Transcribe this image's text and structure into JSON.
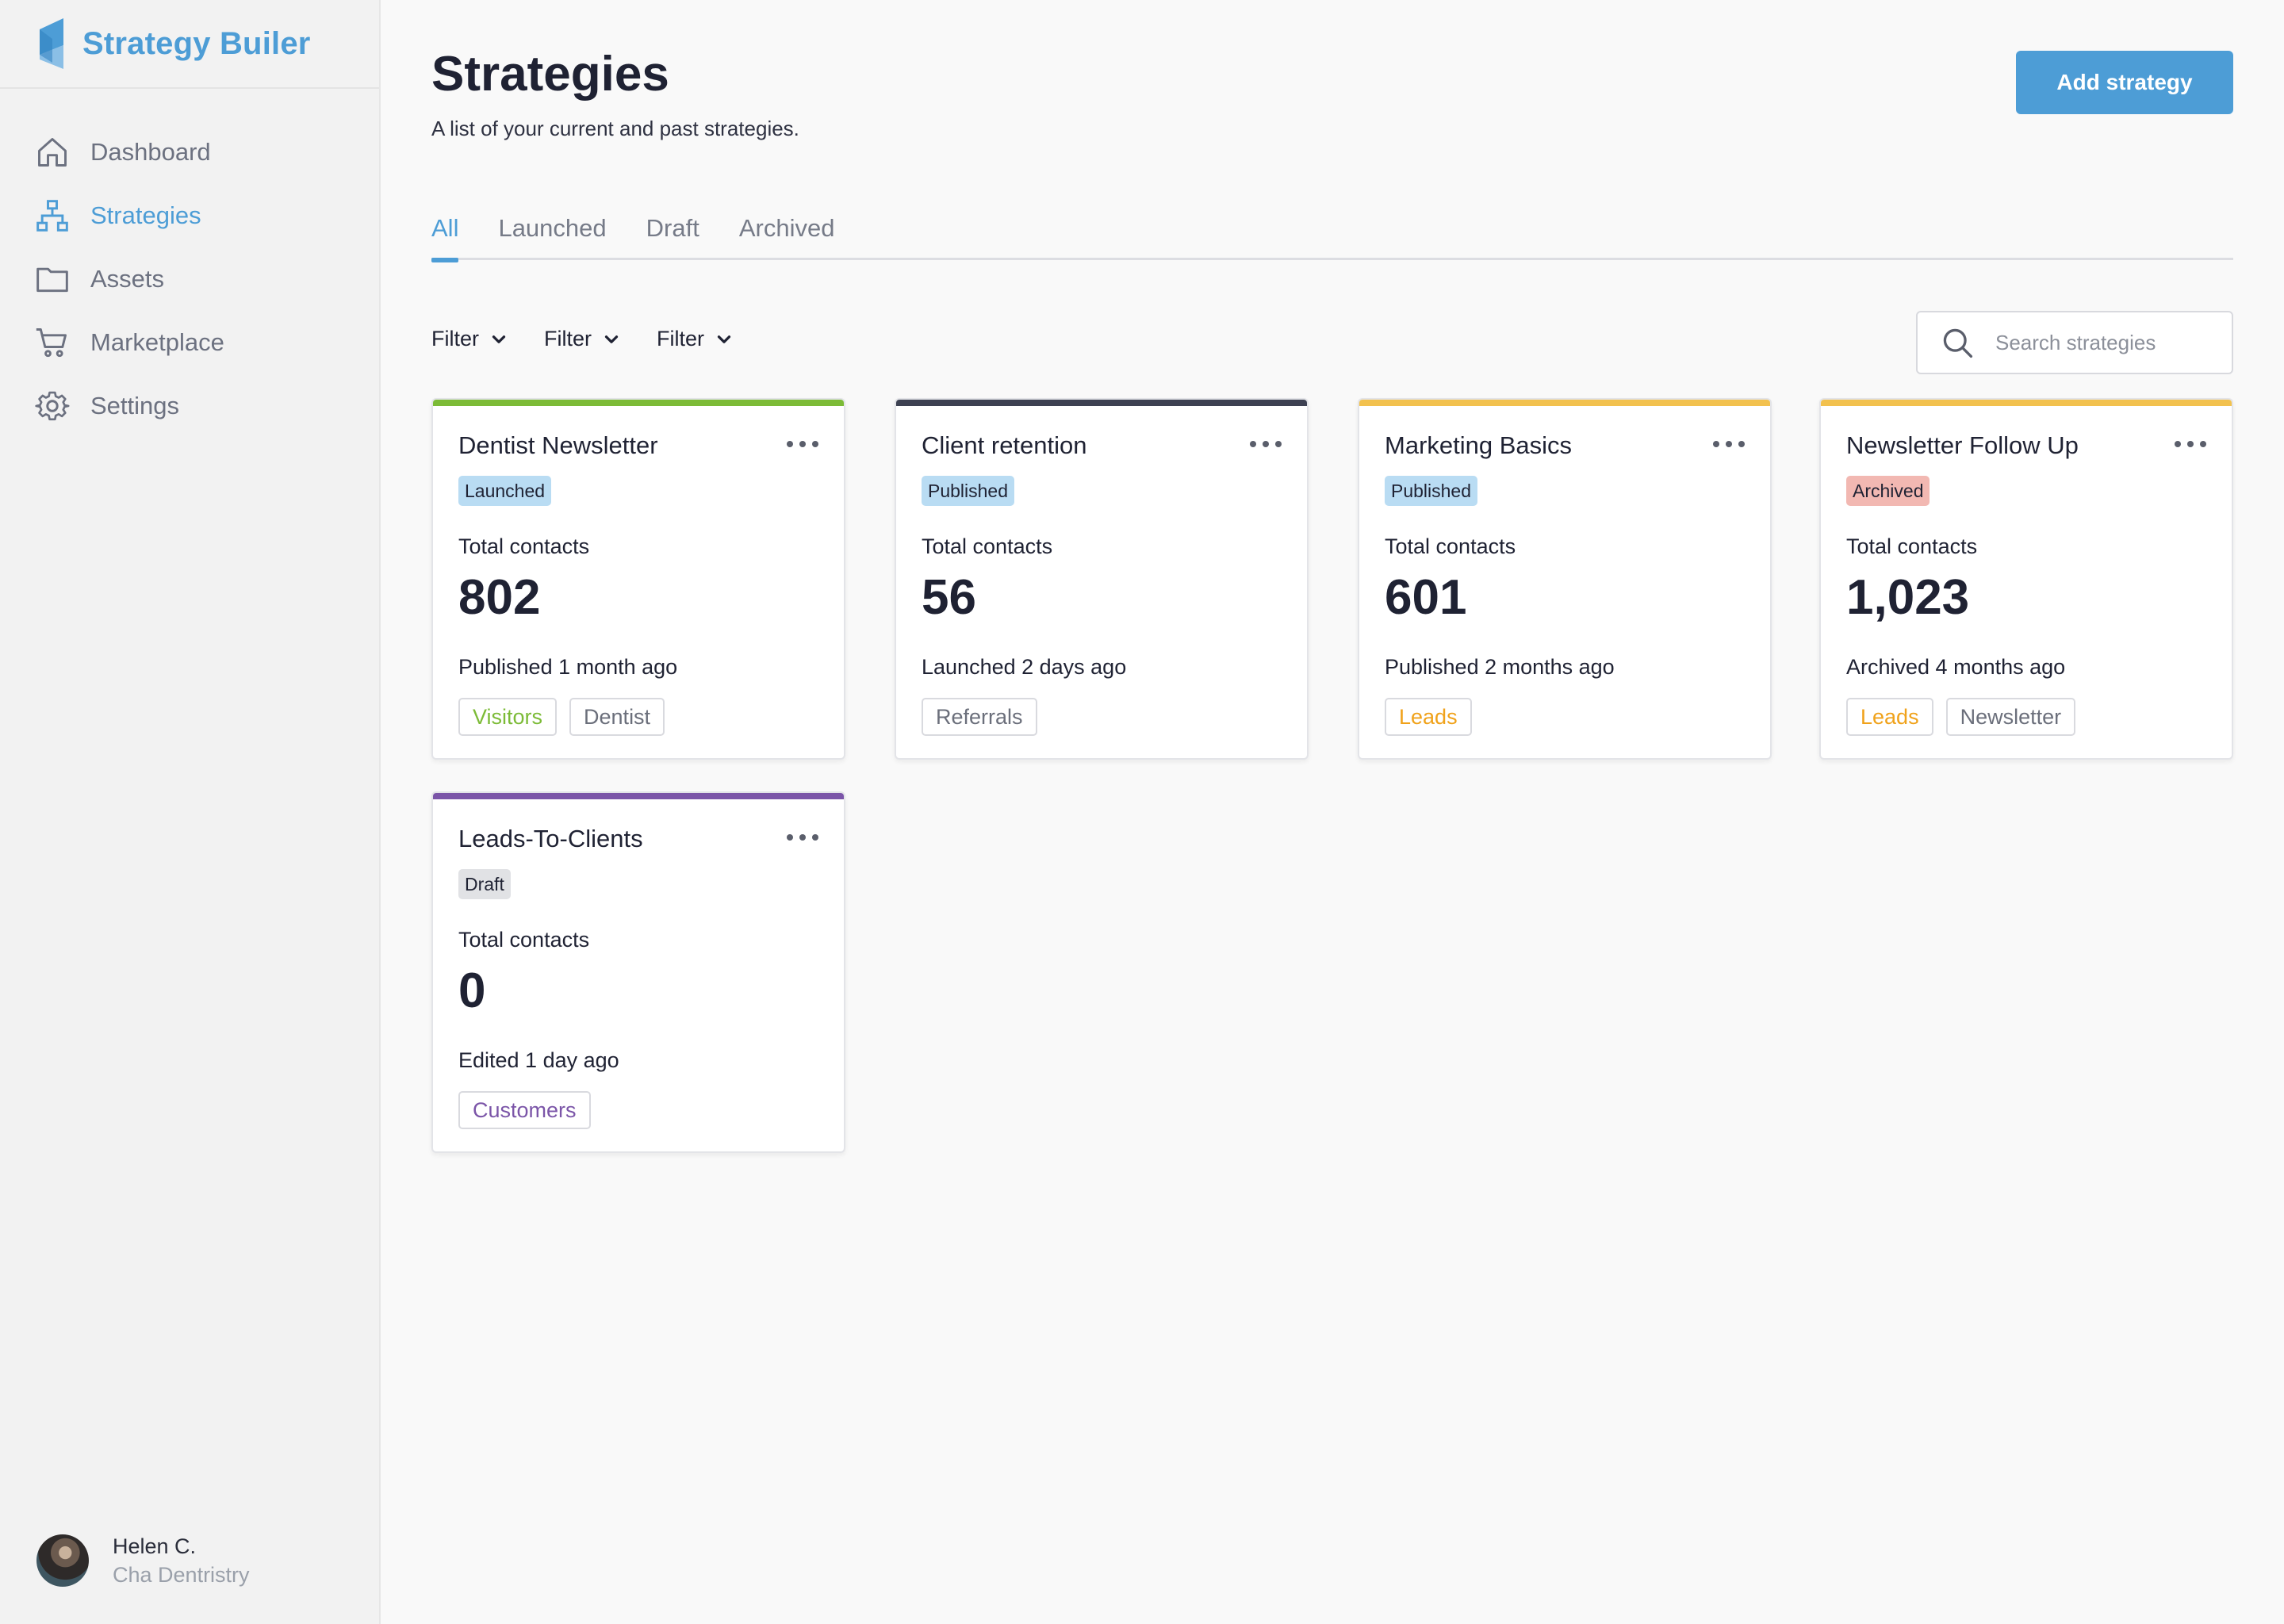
{
  "app": {
    "name": "Strategy Builer"
  },
  "sidebar": {
    "items": [
      {
        "label": "Dashboard",
        "icon": "home-icon",
        "active": false
      },
      {
        "label": "Strategies",
        "icon": "sitemap-icon",
        "active": true
      },
      {
        "label": "Assets",
        "icon": "folder-icon",
        "active": false
      },
      {
        "label": "Marketplace",
        "icon": "cart-icon",
        "active": false
      },
      {
        "label": "Settings",
        "icon": "gear-icon",
        "active": false
      }
    ],
    "user": {
      "name": "Helen C.",
      "org": "Cha Dentristry"
    }
  },
  "main": {
    "title": "Strategies",
    "subtitle": "A list of your current and past strategies.",
    "add_label": "Add strategy",
    "tabs": [
      {
        "label": "All",
        "active": true
      },
      {
        "label": "Launched",
        "active": false
      },
      {
        "label": "Draft",
        "active": false
      },
      {
        "label": "Archived",
        "active": false
      }
    ],
    "filters": [
      "Filter",
      "Filter",
      "Filter"
    ],
    "search_placeholder": "Search strategies"
  },
  "cards": [
    {
      "title": "Dentist Newsletter",
      "accent": "#7cbb37",
      "status": "Launched",
      "status_color": "#b9dcf3",
      "contacts_label": "Total contacts",
      "contacts": "802",
      "time": "Published 1 month ago",
      "tags": [
        {
          "label": "Visitors",
          "color": "green"
        },
        {
          "label": "Dentist",
          "color": "gray"
        }
      ]
    },
    {
      "title": "Client retention",
      "accent": "#3d4152",
      "status": "Published",
      "status_color": "#b9dcf3",
      "contacts_label": "Total contacts",
      "contacts": "56",
      "time": "Launched 2 days ago",
      "tags": [
        {
          "label": "Referrals",
          "color": "gray"
        }
      ]
    },
    {
      "title": "Marketing Basics",
      "accent": "#f2c14e",
      "status": "Published",
      "status_color": "#b9dcf3",
      "contacts_label": "Total contacts",
      "contacts": "601",
      "time": "Published 2 months ago",
      "tags": [
        {
          "label": "Leads",
          "color": "orange"
        }
      ]
    },
    {
      "title": "Newsletter Follow Up",
      "accent": "#f2c14e",
      "status": "Archived",
      "status_color": "#f2b8b2",
      "contacts_label": "Total contacts",
      "contacts": "1,023",
      "time": "Archived 4 months ago",
      "tags": [
        {
          "label": "Leads",
          "color": "orange"
        },
        {
          "label": "Newsletter",
          "color": "gray"
        }
      ]
    },
    {
      "title": "Leads-To-Clients",
      "accent": "#7b55a8",
      "status": "Draft",
      "status_color": "#e1e2e5",
      "contacts_label": "Total contacts",
      "contacts": "0",
      "time": "Edited 1 day ago",
      "tags": [
        {
          "label": "Customers",
          "color": "purple"
        }
      ]
    }
  ]
}
